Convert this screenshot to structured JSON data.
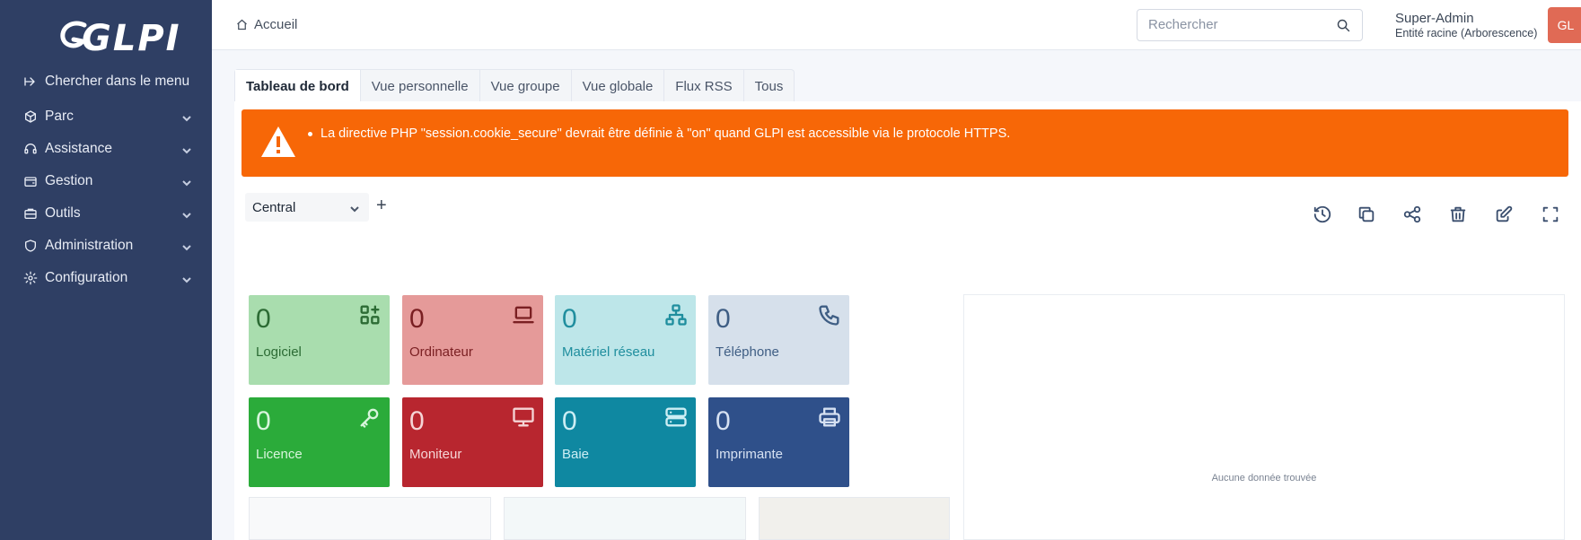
{
  "sidebar": {
    "logo": "GLPI",
    "search_menu": "Chercher dans le menu",
    "items": [
      {
        "label": "Parc",
        "icon": "box-icon"
      },
      {
        "label": "Assistance",
        "icon": "headset-icon"
      },
      {
        "label": "Gestion",
        "icon": "wallet-icon"
      },
      {
        "label": "Outils",
        "icon": "briefcase-icon"
      },
      {
        "label": "Administration",
        "icon": "shield-icon"
      },
      {
        "label": "Configuration",
        "icon": "gear-icon"
      }
    ]
  },
  "header": {
    "breadcrumb": "Accueil",
    "search_placeholder": "Rechercher",
    "user_name": "Super-Admin",
    "user_entity": "Entité racine (Arborescence)",
    "avatar_initials": "GL"
  },
  "tabs": [
    "Tableau de bord",
    "Vue personnelle",
    "Vue groupe",
    "Vue globale",
    "Flux RSS",
    "Tous"
  ],
  "alert": {
    "message": "La directive PHP \"session.cookie_secure\" devrait être définie à \"on\" quand GLPI est accessible via le protocole HTTPS."
  },
  "dashboard": {
    "selected": "Central",
    "add_label": "+"
  },
  "cards": [
    {
      "value": "0",
      "label": "Logiciel",
      "icon": "apps-icon",
      "bg": "#a9ddae",
      "fg": "#2c6b34"
    },
    {
      "value": "0",
      "label": "Ordinateur",
      "icon": "laptop-icon",
      "bg": "#e59a99",
      "fg": "#7a1f22"
    },
    {
      "value": "0",
      "label": "Matériel réseau",
      "icon": "network-icon",
      "bg": "#bde6e9",
      "fg": "#1f8e9e"
    },
    {
      "value": "0",
      "label": "Téléphone",
      "icon": "phone-icon",
      "bg": "#d6e0eb",
      "fg": "#3f5e84"
    },
    {
      "value": "0",
      "label": "Licence",
      "icon": "key-icon",
      "bg": "#2bab3a",
      "fg": "#d8f5dc"
    },
    {
      "value": "0",
      "label": "Moniteur",
      "icon": "monitor-icon",
      "bg": "#b8262f",
      "fg": "#f5d5d6"
    },
    {
      "value": "0",
      "label": "Baie",
      "icon": "server-icon",
      "bg": "#0f88a1",
      "fg": "#cdeef4"
    },
    {
      "value": "0",
      "label": "Imprimante",
      "icon": "printer-icon",
      "bg": "#2f508a",
      "fg": "#d6e1f2"
    }
  ],
  "chart": {
    "empty_text": "Aucune donnée trouvée"
  },
  "colors": {
    "sidebar": "#2f3f64",
    "alert": "#f76707",
    "avatar": "#e06a55"
  }
}
